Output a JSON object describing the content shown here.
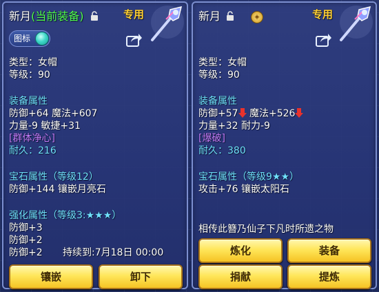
{
  "left": {
    "name": "新月",
    "equipped_tag": "(当前装备)",
    "exclusive": "专用",
    "toggle_label": "图标",
    "type_line": "类型：女帽",
    "level_line": "等级：90",
    "equip_attr_label": "装备属性",
    "attr_line1": "防御+64 魔法+607",
    "attr_line2": "力量-9 敏捷+31",
    "special": "[群体净心]",
    "durability": "耐久：216",
    "gem_label": "宝石属性（等级12）",
    "gem_line": "防御+144 镶嵌月亮石",
    "enhance_label": "强化属性（等级3:★★★）",
    "enhance_line1": "防御+3",
    "enhance_line2": "防御+2",
    "enhance_line3": "防御+2",
    "duration": "持续到:7月18日 00:00",
    "buttons": [
      "镶嵌",
      "卸下"
    ]
  },
  "right": {
    "name": "新月",
    "exclusive": "专用",
    "type_line": "类型：女帽",
    "level_line": "等级：90",
    "equip_attr_label": "装备属性",
    "def": "防御+57",
    "magic": "魔法+526",
    "attr_line2": "力量+32 耐力-9",
    "special": "[爆破]",
    "durability": "耐久：380",
    "gem_label": "宝石属性（等级9★★）",
    "gem_line": "攻击+76 镶嵌太阳石",
    "lore": "相传此簪乃仙子下凡时所遗之物",
    "buttons": [
      "炼化",
      "装备",
      "捐献",
      "提炼"
    ]
  },
  "colors": {
    "attr_label": "#6fe0ff",
    "equipped": "#52ff52",
    "special": "#c57dff",
    "exclusive": "#ffd033",
    "down_arrow": "#e8322c"
  },
  "icons": [
    "lock-icon",
    "share-icon",
    "weapon-icon",
    "badge-icon",
    "down-arrow-icon"
  ]
}
